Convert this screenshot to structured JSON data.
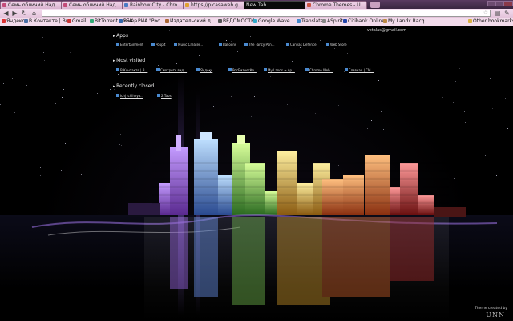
{
  "tabs": [
    {
      "title": "Семь обличий Над...",
      "fav": "#c44b7a",
      "active": false
    },
    {
      "title": "Семь обличий Над...",
      "fav": "#c44b7a",
      "active": false
    },
    {
      "title": "Rainbow City - Chro...",
      "fav": "#4b7ac4",
      "active": false
    },
    {
      "title": "https://picasaweb.g...",
      "fav": "#e0a030",
      "active": false
    },
    {
      "title": "New Tab",
      "fav": "",
      "active": true
    },
    {
      "title": "Chrome Themes - U...",
      "fav": "#cc5544",
      "active": false
    }
  ],
  "bookmarks": [
    {
      "label": "Яндекс",
      "color": "#d33"
    },
    {
      "label": "В Контакте | Ви...",
      "color": "#4a6fa5"
    },
    {
      "label": "Gmail",
      "color": "#c33"
    },
    {
      "label": "BitTorrent трекер...",
      "color": "#3a7"
    },
    {
      "label": "РБК - РИА \"Рос...",
      "color": "#36a"
    },
    {
      "label": "Издательский д...",
      "color": "#a63"
    },
    {
      "label": "ВЕДОМОСТИ",
      "color": "#555"
    },
    {
      "label": "Google Wave",
      "color": "#3ac"
    },
    {
      "label": "Translate",
      "color": "#48c"
    },
    {
      "label": "ASpirit",
      "color": "#888"
    },
    {
      "label": "Citibank Online",
      "color": "#24a"
    },
    {
      "label": "My Landx Racq...",
      "color": "#b84"
    },
    {
      "label": "Other bookmarks",
      "color": "#d9b040"
    }
  ],
  "user_email": "vetalas@gmail.com",
  "sections": {
    "apps": "Apps",
    "most_visited": "Most visited",
    "recently_closed": "Recently closed"
  },
  "apps": [
    {
      "label": "Entertainment"
    },
    {
      "label": "Poppit"
    },
    {
      "label": "Music Creater..."
    },
    {
      "label": "Balloons"
    },
    {
      "label": "The Fancy Pan..."
    },
    {
      "label": "Canvas Defence"
    },
    {
      "label": "Web Store"
    }
  ],
  "most_visited": [
    {
      "label": "В Контакте | В..."
    },
    {
      "label": "Смотреть вид..."
    },
    {
      "label": "Яндекс"
    },
    {
      "label": "РосБизнесКо..."
    },
    {
      "label": "My Lands → Ар..."
    },
    {
      "label": "Chrome Web..."
    },
    {
      "label": "Главная | СМ..."
    }
  ],
  "recently_closed": [
    {
      "label": "Ichi Ichiheya..."
    },
    {
      "label": "2 Tabs"
    }
  ],
  "credit": {
    "label": "Theme created by",
    "logo": "UNN"
  }
}
